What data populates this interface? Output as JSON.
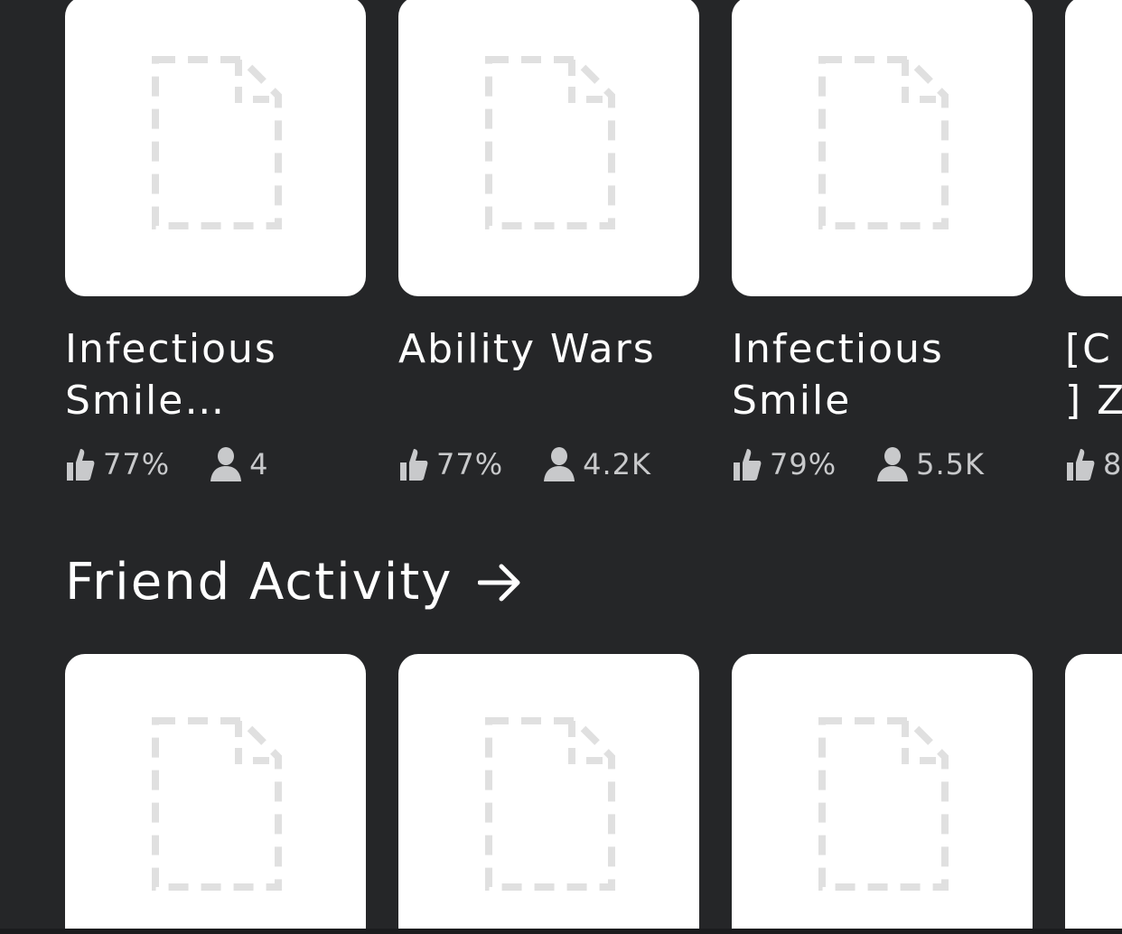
{
  "games": [
    {
      "title_line1": "Infectious",
      "title_line2": "Smile…",
      "rating": "77%",
      "players": "4"
    },
    {
      "title_line1": "Ability Wars",
      "title_line2": "",
      "rating": "77%",
      "players": "4.2K"
    },
    {
      "title_line1": "Infectious",
      "title_line2": "Smile",
      "rating": "79%",
      "players": "5.5K"
    },
    {
      "title_line1": "[C",
      "title_line2": "] Z",
      "rating": "8",
      "players": ""
    }
  ],
  "friend_activity": {
    "title": "Friend Activity"
  },
  "icons": {
    "placeholder": "file-placeholder-icon",
    "rating": "thumbs-up-icon",
    "players": "person-icon",
    "arrow": "arrow-right-icon"
  },
  "colors": {
    "background": "#252628",
    "card": "#ffffff",
    "stat_text": "#c8c9cb",
    "placeholder_stroke": "#e0e0e0"
  }
}
